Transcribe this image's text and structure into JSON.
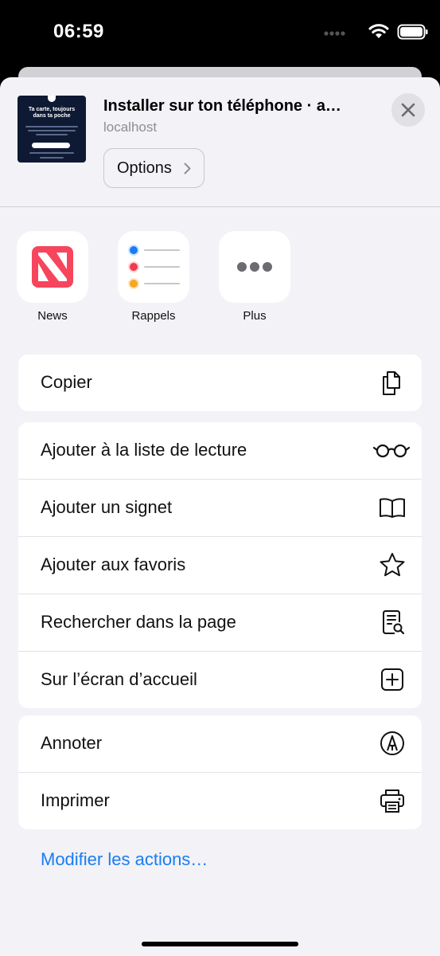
{
  "status": {
    "time": "06:59"
  },
  "share_header": {
    "title": "Installer sur ton téléphone · a…",
    "subtitle": "localhost",
    "options_label": "Options",
    "thumbnail_title": "Ta carte, toujours dans ta poche"
  },
  "apps": [
    {
      "label": "News",
      "icon": "news-icon"
    },
    {
      "label": "Rappels",
      "icon": "reminders-icon"
    },
    {
      "label": "Plus",
      "icon": "more-icon"
    }
  ],
  "actions": {
    "group1": [
      {
        "label": "Copier",
        "icon": "copy-icon"
      }
    ],
    "group2": [
      {
        "label": "Ajouter à la liste de lecture",
        "icon": "glasses-icon"
      },
      {
        "label": "Ajouter un signet",
        "icon": "book-icon"
      },
      {
        "label": "Ajouter aux favoris",
        "icon": "star-icon"
      },
      {
        "label": "Rechercher dans la page",
        "icon": "find-in-page-icon"
      },
      {
        "label": "Sur l’écran d’accueil",
        "icon": "add-square-icon"
      }
    ],
    "group3": [
      {
        "label": "Annoter",
        "icon": "markup-icon"
      },
      {
        "label": "Imprimer",
        "icon": "printer-icon"
      }
    ]
  },
  "edit_actions_label": "Modifier les actions…",
  "colors": {
    "link": "#1a7cf5",
    "sheet_bg": "#f2f2f7",
    "news_red": "#f6455d"
  }
}
